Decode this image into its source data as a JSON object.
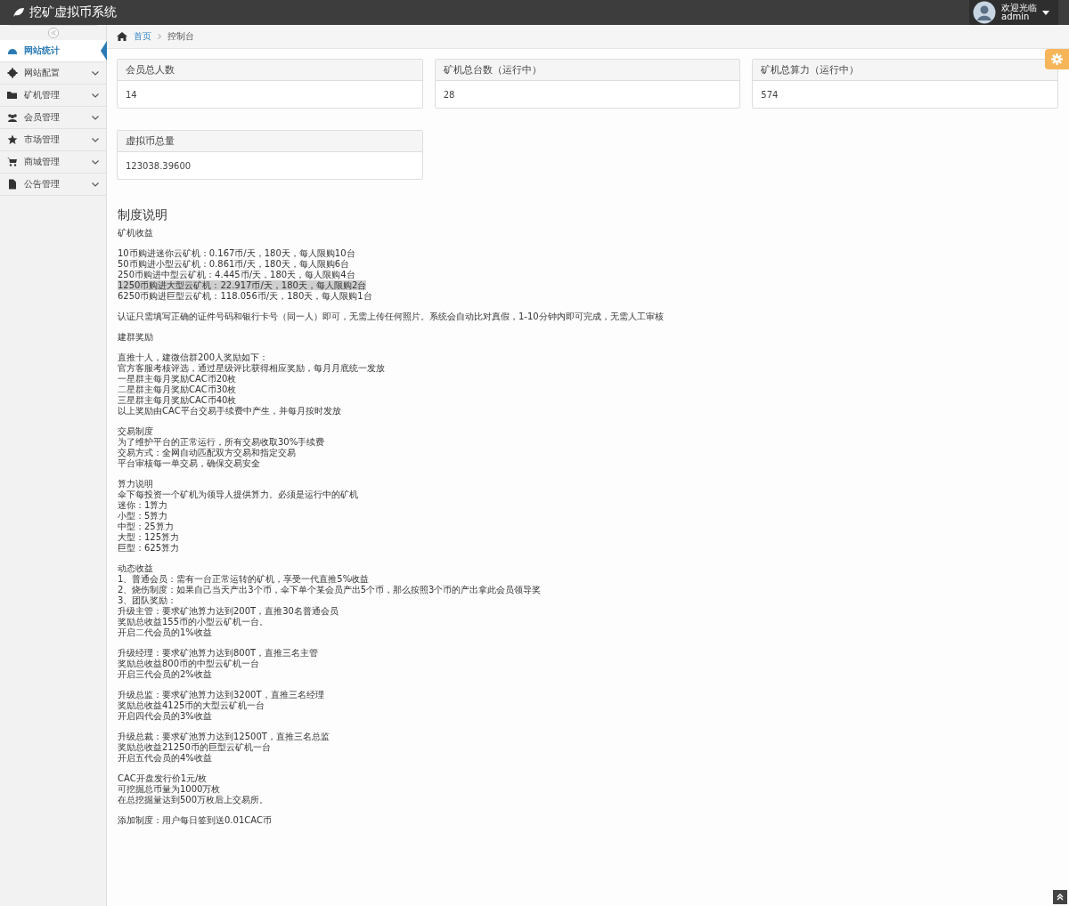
{
  "header": {
    "title": "挖矿虚拟币系统",
    "user": {
      "greeting": "欢迎光临",
      "name": "admin"
    }
  },
  "sidebar": {
    "items": [
      {
        "label": "网站统计",
        "selected": true,
        "has_submenu": false
      },
      {
        "label": "网站配置",
        "selected": false,
        "has_submenu": true
      },
      {
        "label": "矿机管理",
        "selected": false,
        "has_submenu": true
      },
      {
        "label": "会员管理",
        "selected": false,
        "has_submenu": true
      },
      {
        "label": "市场管理",
        "selected": false,
        "has_submenu": true
      },
      {
        "label": "商城管理",
        "selected": false,
        "has_submenu": true
      },
      {
        "label": "公告管理",
        "selected": false,
        "has_submenu": true
      }
    ]
  },
  "breadcrumb": {
    "items": [
      {
        "label": "首页",
        "link": true
      },
      {
        "label": "控制台",
        "link": false
      }
    ]
  },
  "stats": [
    {
      "title": "会员总人数",
      "value": "14"
    },
    {
      "title": "矿机总台数（运行中）",
      "value": "28"
    },
    {
      "title": "矿机总算力（运行中）",
      "value": "574"
    },
    {
      "title": "虚拟币总量",
      "value": "123038.39600"
    }
  ],
  "rules": {
    "title": "制度说明",
    "blocks": [
      {
        "lines": [
          {
            "text": "矿机收益"
          }
        ]
      },
      {
        "lines": [
          {
            "text": "10币购进迷你云矿机：0.167币/天，180天，每人限购10台",
            "highlighted": false
          },
          {
            "text": "50币购进小型云矿机：0.861币/天，180天，每人限购6台",
            "highlighted": false
          },
          {
            "text": "250币购进中型云矿机：4.445币/天，180天，每人限购4台",
            "highlighted": false
          },
          {
            "text": "1250币购进大型云矿机：22.917币/天，180天，每人限购2台",
            "highlighted": true
          },
          {
            "text": "6250币购进巨型云矿机：118.056币/天，180天，每人限购1台",
            "highlighted": false
          }
        ]
      },
      {
        "lines": [
          {
            "text": "认证只需填写正确的证件号码和银行卡号（同一人）即可，无需上传任何照片。系统会自动比对真假，1-10分钟内即可完成，无需人工审核"
          }
        ]
      },
      {
        "lines": [
          {
            "text": "建群奖励"
          }
        ]
      },
      {
        "lines": [
          {
            "text": "直推十人，建微信群200人奖励如下："
          },
          {
            "text": "官方客服考核评选，通过星级评比获得相应奖励，每月月底统一发放"
          },
          {
            "text": "一星群主每月奖励CAC币20枚"
          },
          {
            "text": "二星群主每月奖励CAC币30枚"
          },
          {
            "text": "三星群主每月奖励CAC币40枚"
          },
          {
            "text": "以上奖励由CAC平台交易手续费中产生，并每月按时发放"
          }
        ]
      },
      {
        "lines": [
          {
            "text": "交易制度"
          },
          {
            "text": "为了维护平台的正常运行，所有交易收取30%手续费"
          },
          {
            "text": "交易方式：全网自动匹配双方交易和指定交易"
          },
          {
            "text": "平台审核每一单交易，确保交易安全"
          }
        ]
      },
      {
        "lines": [
          {
            "text": "算力说明"
          },
          {
            "text": "伞下每投资一个矿机为领导人提供算力。必须是运行中的矿机"
          },
          {
            "text": "迷你：1算力"
          },
          {
            "text": "小型：5算力"
          },
          {
            "text": "中型：25算力"
          },
          {
            "text": "大型：125算力"
          },
          {
            "text": "巨型：625算力"
          }
        ]
      },
      {
        "lines": [
          {
            "text": "动态收益"
          },
          {
            "text": "1、普通会员：需有一台正常运转的矿机，享受一代直推5%收益"
          },
          {
            "text": "2、烧伤制度：如果自己当天产出3个币，伞下单个某会员产出5个币，那么按照3个币的产出拿此会员领导奖"
          },
          {
            "text": "3、团队奖励："
          },
          {
            "text": "升级主管：要求矿池算力达到200T，直推30名普通会员"
          },
          {
            "text": "奖励总收益155币的小型云矿机一台。"
          },
          {
            "text": "开启二代会员的1%收益"
          }
        ]
      },
      {
        "lines": [
          {
            "text": "升级经理：要求矿池算力达到800T，直推三名主管"
          },
          {
            "text": "奖励总收益800币的中型云矿机一台"
          },
          {
            "text": "开启三代会员的2%收益"
          }
        ]
      },
      {
        "lines": [
          {
            "text": "升级总监：要求矿池算力达到3200T，直推三名经理"
          },
          {
            "text": "奖励总收益4125币的大型云矿机一台"
          },
          {
            "text": "开启四代会员的3%收益"
          }
        ]
      },
      {
        "lines": [
          {
            "text": "升级总裁：要求矿池算力达到12500T，直推三名总监"
          },
          {
            "text": "奖励总收益21250币的巨型云矿机一台"
          },
          {
            "text": "开启五代会员的4%收益"
          }
        ]
      },
      {
        "lines": [
          {
            "text": "CAC开盘发行价1元/枚"
          },
          {
            "text": "可挖掘总币量为1000万枚"
          },
          {
            "text": "在总挖掘量达到500万枚后上交易所。"
          }
        ]
      },
      {
        "lines": [
          {
            "text": "添加制度：用户每日签到送0.01CAC币"
          }
        ]
      }
    ]
  }
}
